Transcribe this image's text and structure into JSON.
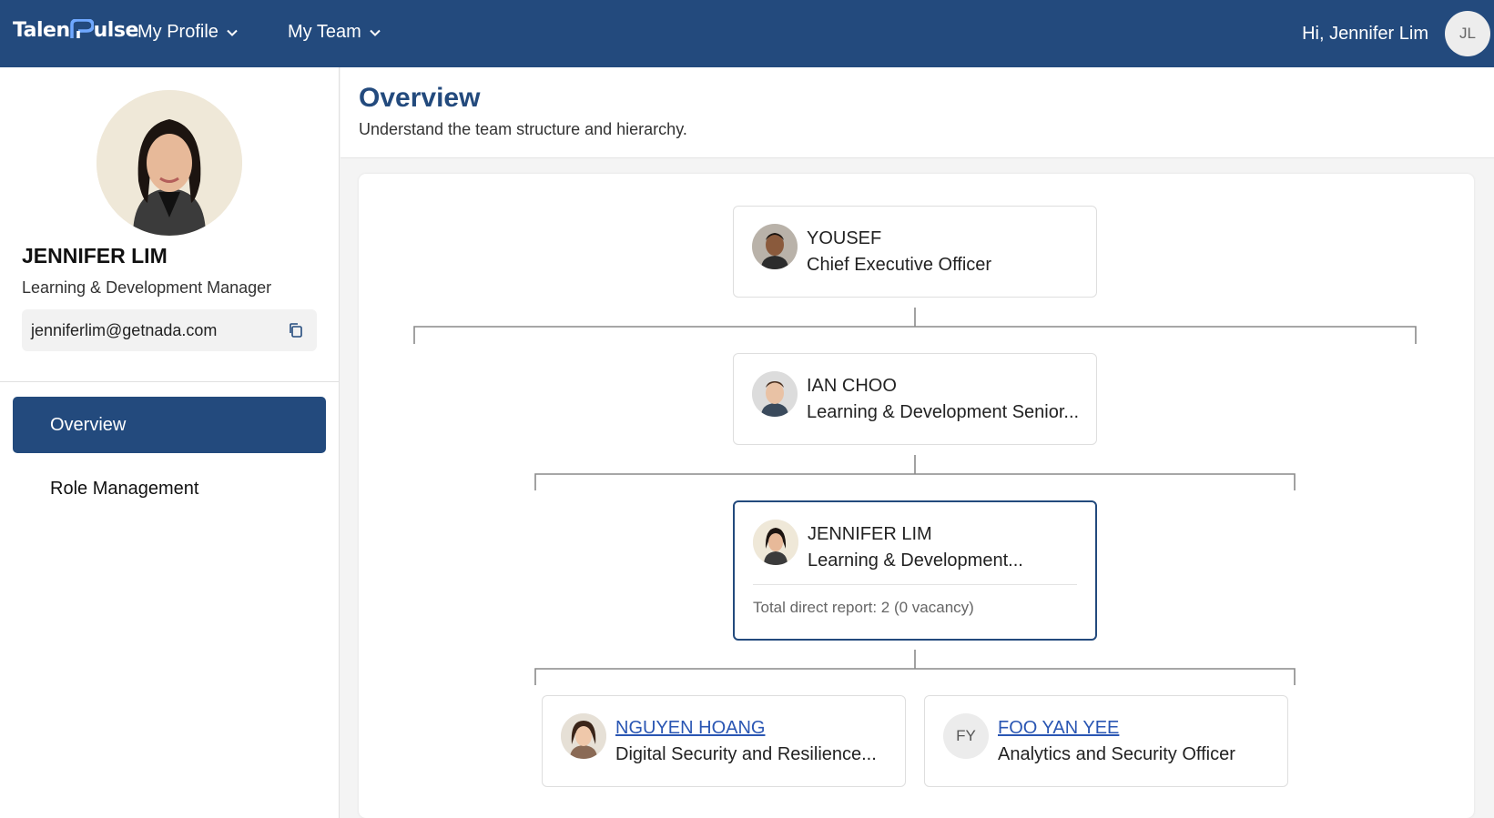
{
  "header": {
    "logo": "TalentPulse",
    "menu": [
      {
        "label": "My Profile"
      },
      {
        "label": "My Team"
      }
    ],
    "greeting": "Hi, Jennifer Lim",
    "avatar_initials": "JL"
  },
  "sidebar": {
    "name": "JENNIFER LIM",
    "role": "Learning & Development Manager",
    "email": "jenniferlim@getnada.com",
    "items": [
      {
        "label": "Overview",
        "active": true
      },
      {
        "label": "Role Management",
        "active": false
      }
    ]
  },
  "main": {
    "title": "Overview",
    "subtitle": "Understand the team structure and hierarchy."
  },
  "org": {
    "ceo": {
      "name": "YOUSEF",
      "title": "Chief Executive Officer"
    },
    "manager": {
      "name": "IAN CHOO",
      "title": "Learning & Development Senior..."
    },
    "current": {
      "name": "JENNIFER LIM",
      "title": "Learning & Development...",
      "footer": "Total direct report: 2 (0 vacancy)"
    },
    "reports": [
      {
        "name": "NGUYEN HOANG",
        "title": "Digital Security and Resilience...",
        "initials": ""
      },
      {
        "name": "FOO YAN YEE",
        "title": "Analytics and Security Officer",
        "initials": "FY"
      }
    ]
  },
  "colors": {
    "primary": "#234a7d",
    "link": "#2a56b3"
  }
}
